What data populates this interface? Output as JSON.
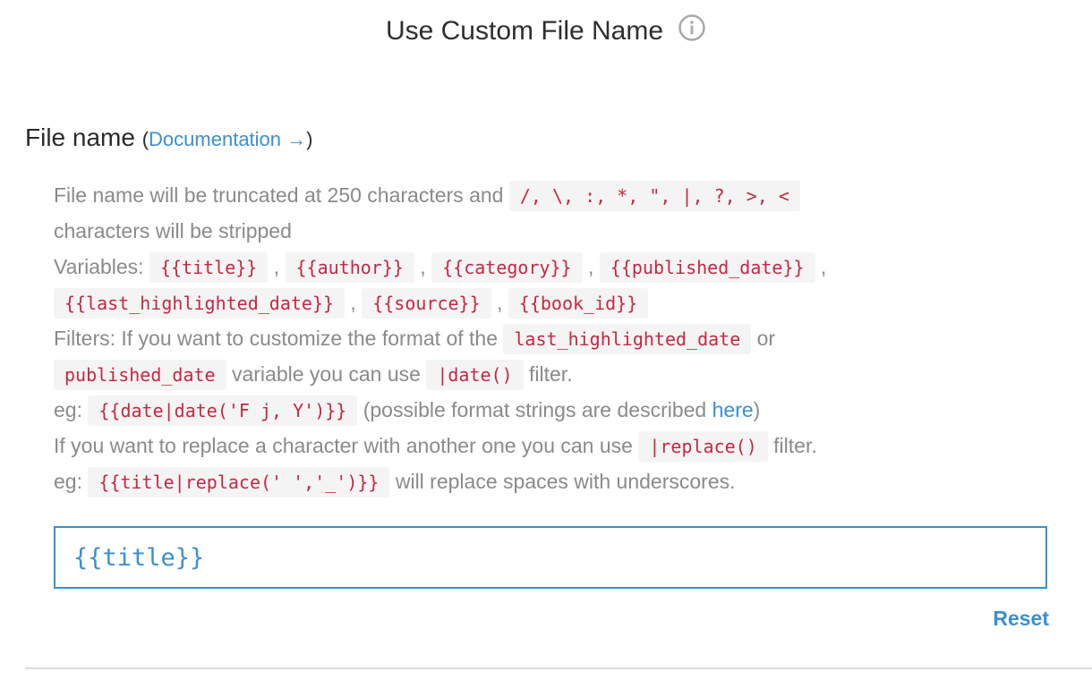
{
  "header": {
    "title": "Use Custom File Name",
    "info_icon": "info-circle-icon"
  },
  "section": {
    "title": "File name",
    "paren_open": "(",
    "doc_link": "Documentation →",
    "paren_close": ")"
  },
  "help": {
    "truncate_text": "File name will be truncated at 250 characters and",
    "stripped_chars": "/, \\, :, *, \", |, ?, >, <",
    "stripped_text": "characters will be stripped",
    "variables_label": "Variables:",
    "variables": [
      "{{title}}",
      "{{author}}",
      "{{category}}",
      "{{published_date}}",
      "{{last_highlighted_date}}",
      "{{source}}",
      "{{book_id}}"
    ],
    "separator": ",",
    "filters_text": "Filters: If you want to customize the format of the",
    "filters_var1": "last_highlighted_date",
    "or_text": "or",
    "filters_var2": "published_date",
    "variable_use_text": "variable you can use",
    "date_filter": "|date()",
    "filter_word": "filter.",
    "eg_label": "eg:",
    "date_example": "{{date|date('F j, Y')}}",
    "possible_text": "(possible format strings are described",
    "here_link": "here",
    "close_paren": ")",
    "replace_text": "If you want to replace a character with another one you can use",
    "replace_filter": "|replace()",
    "replace_example": "{{title|replace(' ','_')}}",
    "replace_result": "will replace spaces with underscores."
  },
  "input": {
    "value": "{{title}}"
  },
  "reset_label": "Reset",
  "colors": {
    "accent": "#3a8fd0",
    "code_text": "#c62743",
    "code_bg": "#f4f4f4",
    "muted_text": "#8a8a8a"
  }
}
